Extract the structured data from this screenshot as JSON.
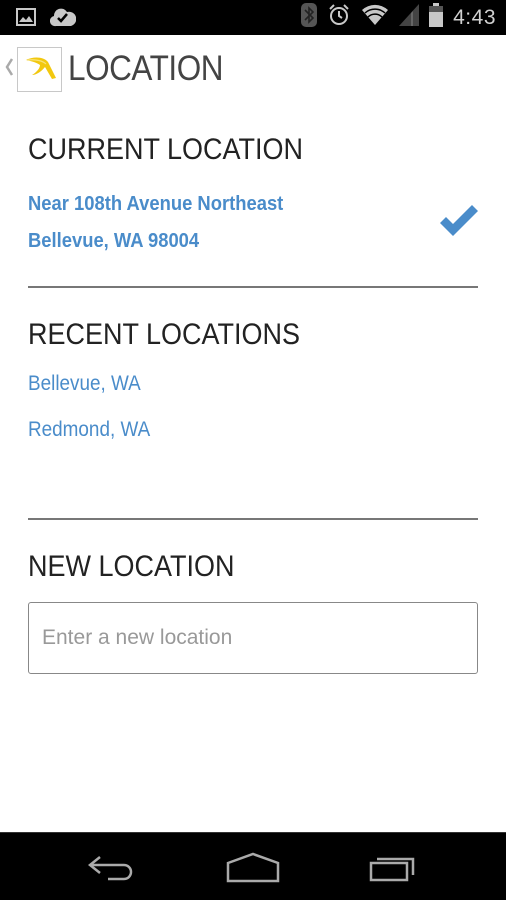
{
  "status_bar": {
    "left_icons": [
      "gallery-icon",
      "cloud-check-icon"
    ],
    "right_icons": [
      "bluetooth-icon",
      "alarm-icon",
      "wifi-icon",
      "signal-icon",
      "battery-icon"
    ],
    "time": "4:43"
  },
  "action_bar": {
    "up_icon": "chevron-left-icon",
    "logo_icon": "app-logo-icon",
    "title": "LOCATION"
  },
  "current_location": {
    "heading": "CURRENT LOCATION",
    "line1": "Near 108th Avenue Northeast",
    "line2": "Bellevue, WA 98004",
    "selected": true,
    "check_icon": "check-icon"
  },
  "recent_locations": {
    "heading": "RECENT LOCATIONS",
    "items": [
      "Bellevue, WA",
      "Redmond, WA"
    ]
  },
  "new_location": {
    "heading": "NEW LOCATION",
    "input_value": "",
    "placeholder": "Enter a new location"
  },
  "nav_bar": {
    "buttons": [
      "back-icon",
      "home-icon",
      "recents-icon"
    ]
  },
  "colors": {
    "accent": "#4a8cca",
    "logo_yellow": "#f2c80f",
    "heading": "#222222",
    "divider": "#777777"
  }
}
